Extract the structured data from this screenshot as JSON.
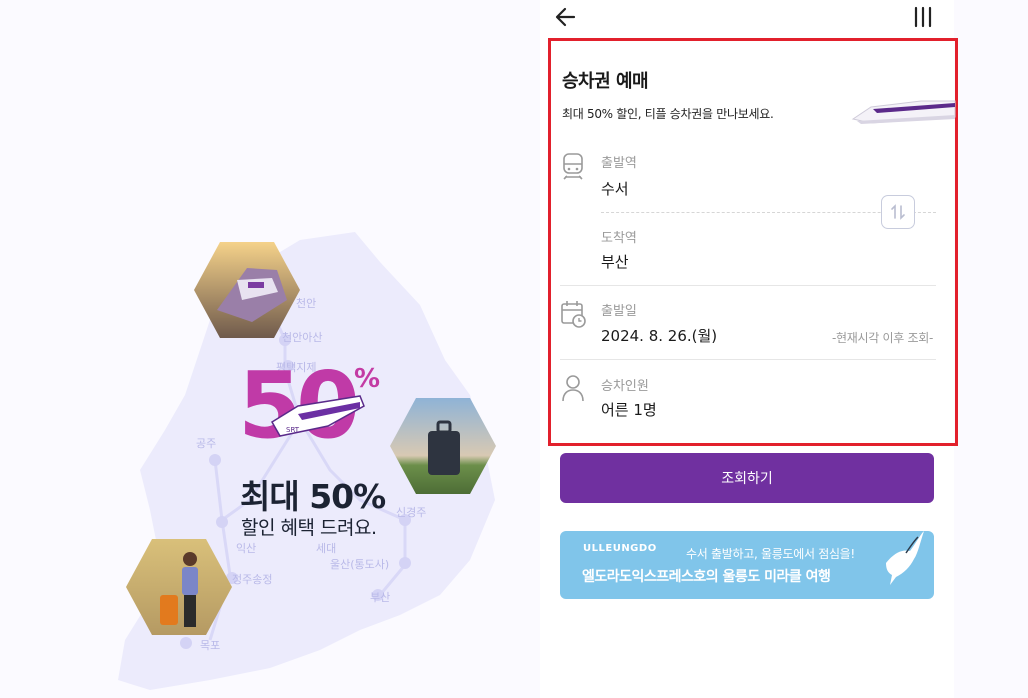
{
  "promo": {
    "big_number": "50",
    "percent_sign": "%",
    "headline": "최대 50%",
    "subline": "할인 혜택 드려요.",
    "train_tag": "SRT",
    "cities": [
      "공주",
      "신경주",
      "익산",
      "세대",
      "울산(통도사)",
      "부산",
      "정주송정",
      "목포",
      "평택지제",
      "천안아산",
      "천안"
    ]
  },
  "topbar": {
    "back_icon": "arrow-left-icon",
    "menu_icon": "menu-bars-icon"
  },
  "booking": {
    "title": "승차권 예매",
    "description": "최대 50% 할인, 티플 승차권을 만나보세요.",
    "departure": {
      "label": "출발역",
      "value": "수서"
    },
    "arrival": {
      "label": "도착역",
      "value": "부산"
    },
    "date": {
      "label": "출발일",
      "value": "2024. 8. 26.(월)",
      "hint": "-현재시각 이후 조회-"
    },
    "passengers": {
      "label": "승차인원",
      "value": "어른 1명"
    }
  },
  "search_button": "조회하기",
  "banner": {
    "logo": "ULLEUNGDO",
    "line1": "수서 출발하고, 울릉도에서 점심을!",
    "line2": "엘도라도익스프레스호의 울릉도 미라클 여행"
  },
  "colors": {
    "accent": "#7030a0",
    "highlight_border": "#e2202c",
    "banner_bg": "#80c5ea"
  }
}
